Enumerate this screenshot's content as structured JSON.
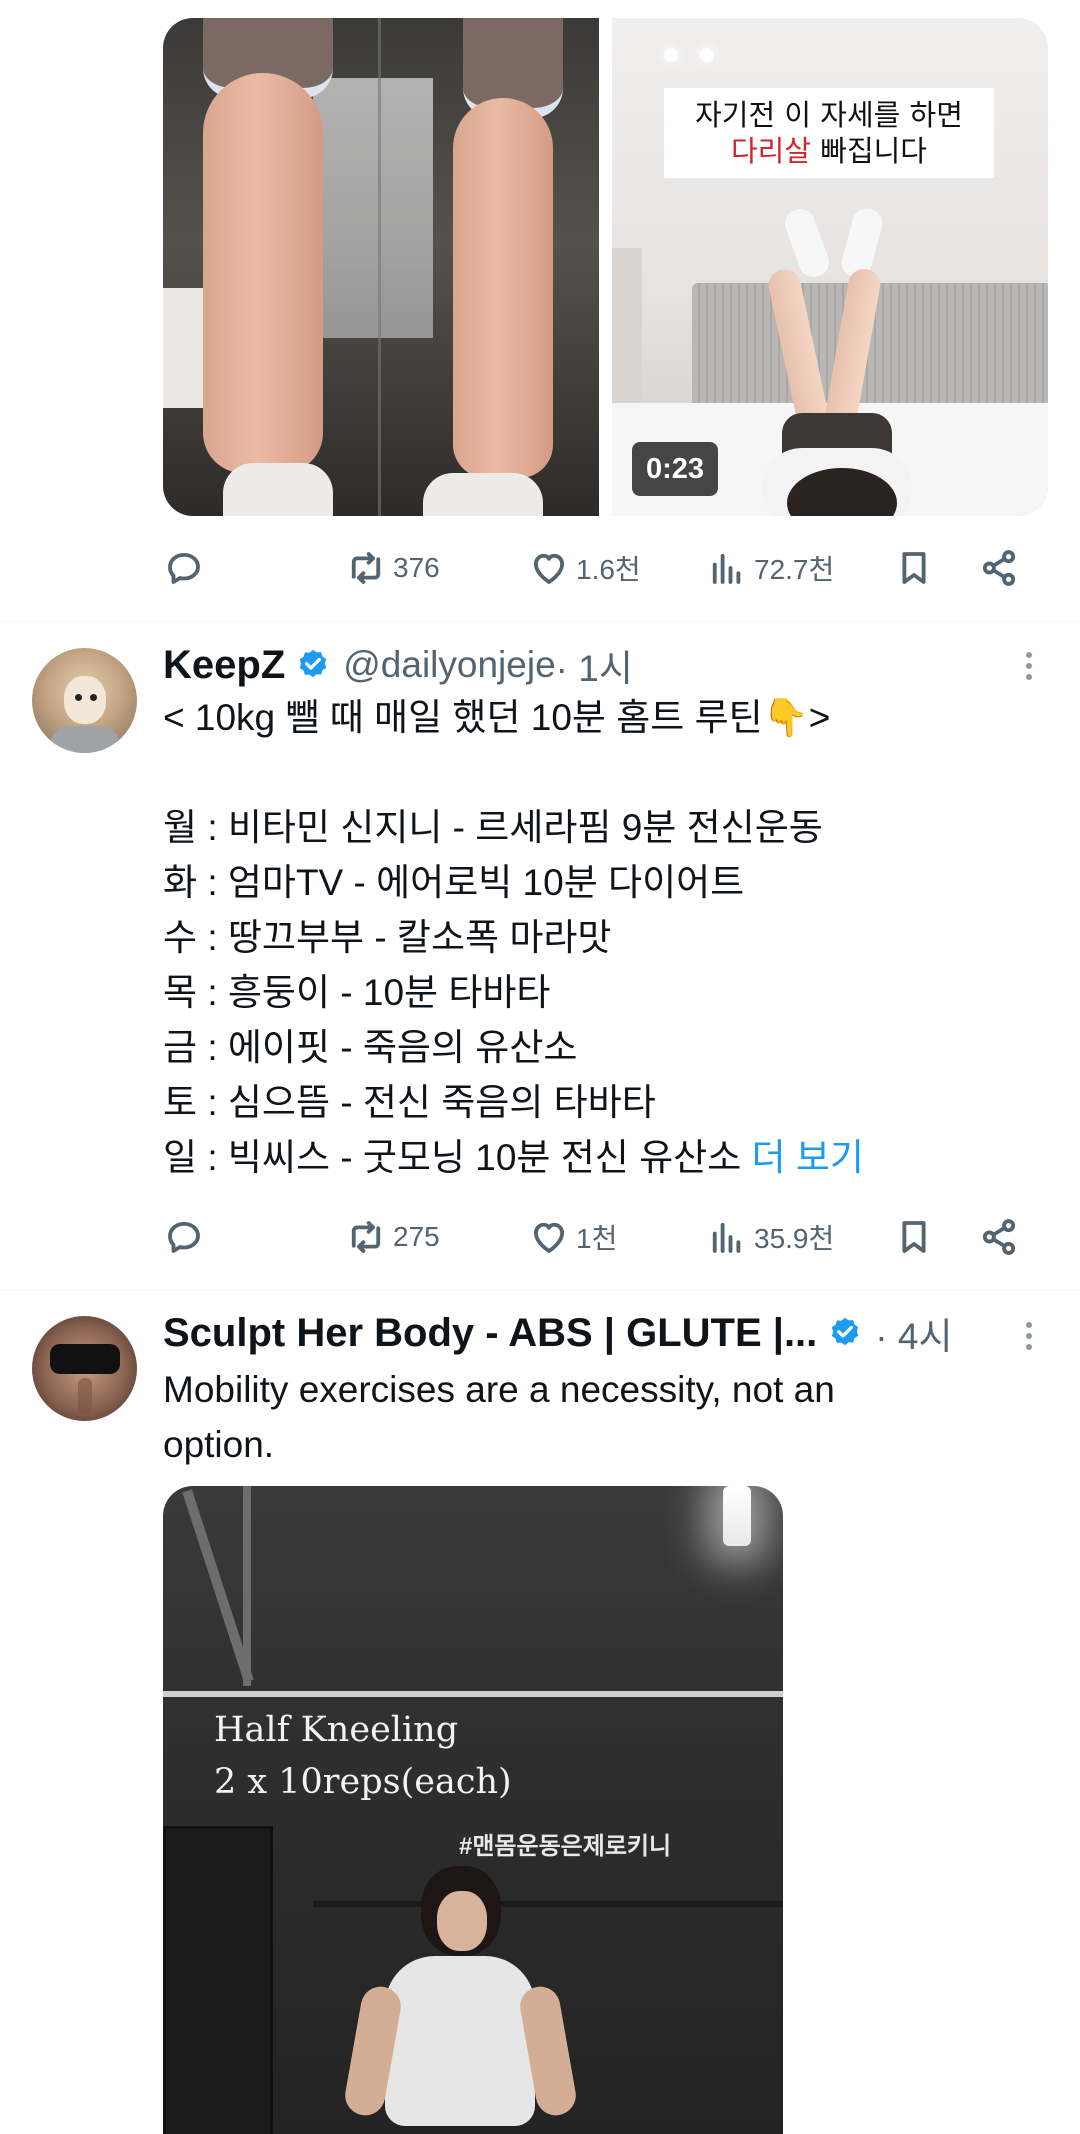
{
  "tweets": [
    {
      "media": {
        "video_duration": "0:23",
        "caption_line1": "자기전 이 자세를 하면",
        "caption_line2_red": "다리살",
        "caption_line2_rest": " 빠집니다"
      },
      "stats": {
        "replies": "",
        "retweets": "376",
        "likes": "1.6천",
        "views": "72.7천"
      }
    },
    {
      "author": {
        "display_name": "KeepZ",
        "handle": "@dailyonjeje",
        "time": " · 1시"
      },
      "text_lines": [
        "< 10kg 뺄 때 매일 했던 10분 홈트 루틴👇>",
        "",
        "월 : 비타민 신지니 - 르세라핌 9분 전신운동",
        "화 : 엄마TV - 에어로빅 10분 다이어트",
        "수 : 땅끄부부 - 칼소폭 마라맛",
        "목 : 흥둥이 - 10분 타바타",
        "금 : 에이핏 - 죽음의 유산소",
        "토 : 심으뜸 - 전신 죽음의 타바타",
        "일 : 빅씨스 - 굿모닝 10분 전신 유산소 "
      ],
      "show_more": "더 보기",
      "stats": {
        "replies": "",
        "retweets": "275",
        "likes": "1천",
        "views": "35.9천"
      }
    },
    {
      "author": {
        "display_name": "Sculpt Her Body - ABS | GLUTE |...",
        "time": " · 4시"
      },
      "text_lines": [
        "Mobility exercises are a necessity, not an",
        "option."
      ],
      "media": {
        "overlay_line1": "Half Kneeling",
        "overlay_line2": "2 x 10reps(each)",
        "hashtag": "#맨몸운동은제로키니"
      }
    }
  ],
  "colors": {
    "accent": "#1d9bf0",
    "text_primary": "#0f1419",
    "text_secondary": "#536471",
    "separator": "#eff3f4",
    "caption_red": "#d0262c"
  },
  "icons": {
    "reply": "reply-icon",
    "retweet": "retweet-icon",
    "like": "heart-icon",
    "views": "views-chart-icon",
    "bookmark": "bookmark-icon",
    "share": "share-icon",
    "verified": "verified-badge-icon",
    "more": "more-options-icon"
  }
}
